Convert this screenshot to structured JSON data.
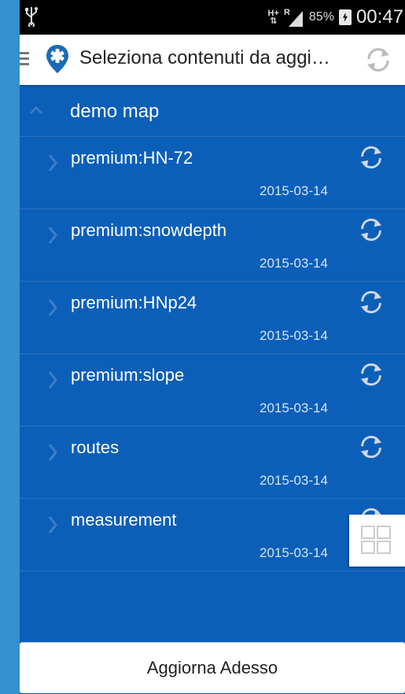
{
  "status_bar": {
    "usb_icon": "usb-icon",
    "network_top": "H+",
    "network_bottom": "⇅",
    "roaming": "R",
    "battery_percent": "85%",
    "time": "00:47"
  },
  "action_bar": {
    "menu_icon": "hamburger-menu-icon",
    "app_icon": "location-pin-icon",
    "title": "Seleziona contenuti da aggi…",
    "sync_icon": "sync-icon"
  },
  "group": {
    "label": "demo map",
    "expanded": true
  },
  "items": [
    {
      "label": "premium:HN-72",
      "date": "2015-03-14"
    },
    {
      "label": "premium:snowdepth",
      "date": "2015-03-14"
    },
    {
      "label": "premium:HNp24",
      "date": "2015-03-14"
    },
    {
      "label": "premium:slope",
      "date": "2015-03-14"
    },
    {
      "label": "routes",
      "date": "2015-03-14"
    },
    {
      "label": "measurement",
      "date": "2015-03-14"
    }
  ],
  "fab": {
    "icon": "grid-icon"
  },
  "footer": {
    "update_button_label": "Aggiorna Adesso"
  },
  "colors": {
    "list_background": "#0c5fb8",
    "side_background": "#2b86c5",
    "app_icon": "#1a6ab8"
  }
}
